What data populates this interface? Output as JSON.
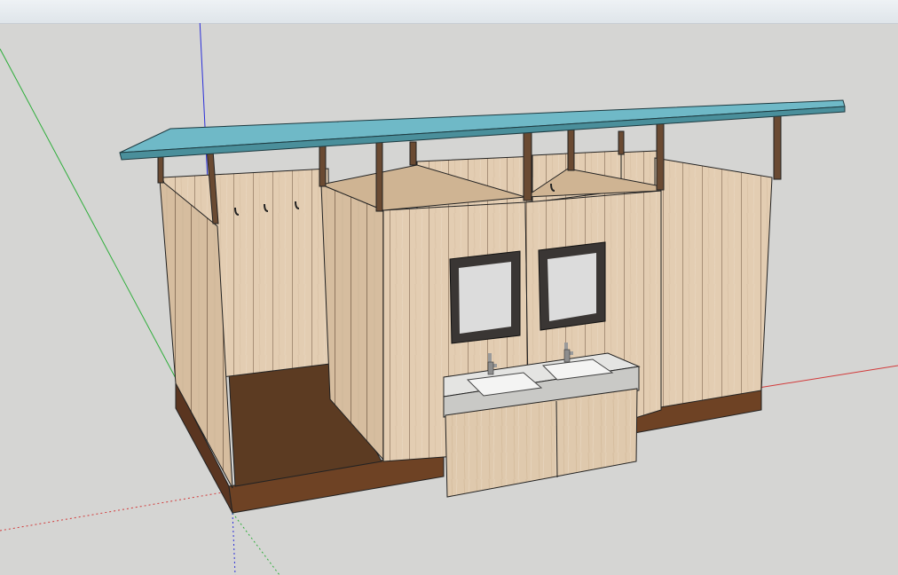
{
  "app": {
    "toolbar": {
      "visible": true
    },
    "viewport": {
      "background_color": "#d5d5d3",
      "model": {
        "subject": "washroom-block",
        "parts": [
          "slanted-roof",
          "posts",
          "shower-cubicles",
          "twin-sink-vanity",
          "mirrors",
          "faucets",
          "coat-hooks",
          "base-plinth"
        ],
        "colors": {
          "roof": "#6fb9c7",
          "wall": "#e2cbb0",
          "post": "#6a4a32",
          "floor": "#5b3a22",
          "plinth": "#6b3f22",
          "mirror_frame": "#3a3634",
          "mirror_glass": "#dcdcdc",
          "countertop": "#e4e4e2",
          "vanity": "#ddc7ad"
        }
      },
      "axes": {
        "red": "#d23a3a",
        "green": "#2fae3b",
        "blue": "#2b2fd8"
      }
    }
  }
}
